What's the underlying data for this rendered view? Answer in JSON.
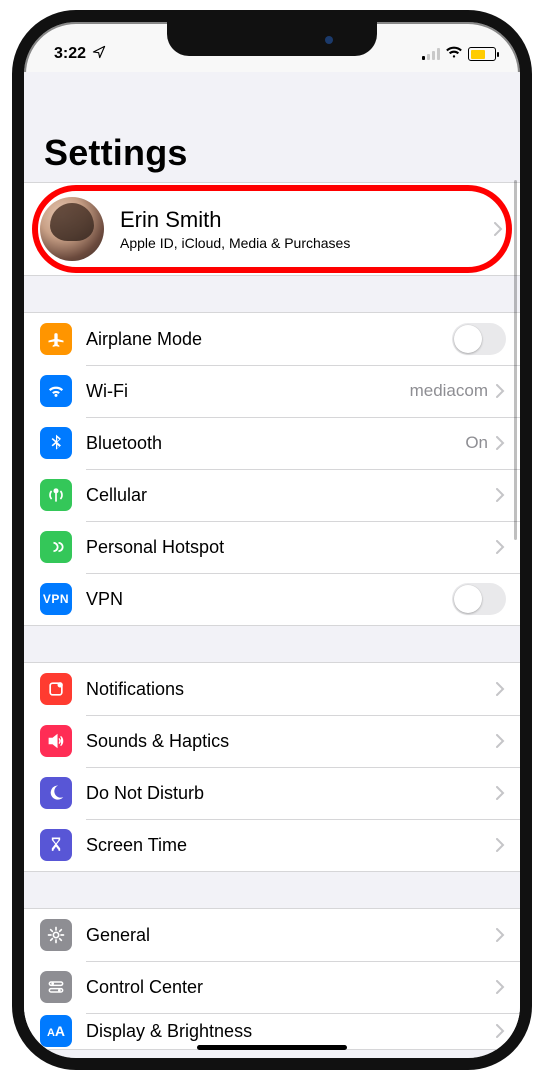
{
  "status": {
    "time": "3:22",
    "wifi_value": "mediacom"
  },
  "title": "Settings",
  "account": {
    "name": "Erin Smith",
    "subtitle": "Apple ID, iCloud, Media & Purchases"
  },
  "groups": [
    {
      "rows": [
        {
          "id": "airplane",
          "label": "Airplane Mode",
          "accessory": "toggle",
          "icon": "airplane",
          "color": "#ff9500"
        },
        {
          "id": "wifi",
          "label": "Wi-Fi",
          "value": "mediacom",
          "accessory": "disclosure",
          "icon": "wifi",
          "color": "#007aff"
        },
        {
          "id": "bluetooth",
          "label": "Bluetooth",
          "value": "On",
          "accessory": "disclosure",
          "icon": "bluetooth",
          "color": "#007aff"
        },
        {
          "id": "cellular",
          "label": "Cellular",
          "accessory": "disclosure",
          "icon": "antenna",
          "color": "#34c759"
        },
        {
          "id": "hotspot",
          "label": "Personal Hotspot",
          "accessory": "disclosure",
          "icon": "link",
          "color": "#34c759"
        },
        {
          "id": "vpn",
          "label": "VPN",
          "accessory": "toggle",
          "icon": "vpn",
          "color": "#007aff"
        }
      ]
    },
    {
      "rows": [
        {
          "id": "notifications",
          "label": "Notifications",
          "accessory": "disclosure",
          "icon": "notifications",
          "color": "#ff3b30"
        },
        {
          "id": "sounds",
          "label": "Sounds & Haptics",
          "accessory": "disclosure",
          "icon": "sounds",
          "color": "#ff2d55"
        },
        {
          "id": "dnd",
          "label": "Do Not Disturb",
          "accessory": "disclosure",
          "icon": "moon",
          "color": "#5856d6"
        },
        {
          "id": "screentime",
          "label": "Screen Time",
          "accessory": "disclosure",
          "icon": "hourglass",
          "color": "#5856d6"
        }
      ]
    },
    {
      "rows": [
        {
          "id": "general",
          "label": "General",
          "accessory": "disclosure",
          "icon": "gear",
          "color": "#8e8e93"
        },
        {
          "id": "controlcenter",
          "label": "Control Center",
          "accessory": "disclosure",
          "icon": "switches",
          "color": "#8e8e93"
        },
        {
          "id": "display",
          "label": "Display & Brightness",
          "accessory": "disclosure",
          "icon": "aa",
          "color": "#007aff"
        }
      ]
    }
  ]
}
